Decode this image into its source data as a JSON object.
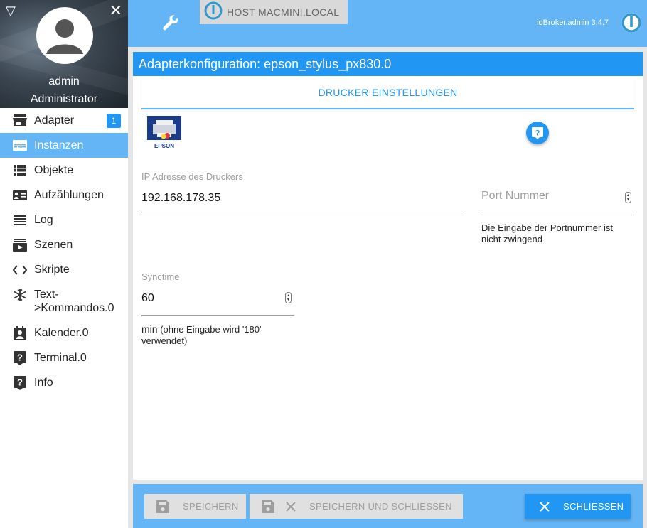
{
  "sidebar": {
    "user_name": "admin",
    "user_role": "Administrator",
    "items": [
      {
        "label": "Adapter",
        "icon": "store-icon",
        "badge": "1",
        "active": false
      },
      {
        "label": "Instanzen",
        "icon": "instances-icon",
        "active": true
      },
      {
        "label": "Objekte",
        "icon": "list-icon",
        "active": false
      },
      {
        "label": "Aufzählungen",
        "icon": "enum-icon",
        "active": false
      },
      {
        "label": "Log",
        "icon": "log-icon",
        "active": false
      },
      {
        "label": "Szenen",
        "icon": "scenes-icon",
        "active": false
      },
      {
        "label": "Skripte",
        "icon": "code-icon",
        "active": false
      },
      {
        "label": "Text->Kommandos.0",
        "icon": "snowflake-icon",
        "active": false
      },
      {
        "label": "Kalender.0",
        "icon": "calendar-icon",
        "active": false
      },
      {
        "label": "Terminal.0",
        "icon": "help-icon",
        "active": false
      },
      {
        "label": "Info",
        "icon": "help-icon",
        "active": false
      }
    ]
  },
  "topbar": {
    "host": "HOST MACMINI.LOCAL",
    "version": "ioBroker.admin 3.4.7"
  },
  "config": {
    "title": "Adapterkonfiguration: epson_stylus_px830.0",
    "tab_label": "DRUCKER EINSTELLUNGEN",
    "logo_text": "EPSON",
    "ip_label": "IP Adresse des Druckers",
    "ip_value": "192.168.178.35",
    "port_placeholder": "Port Nummer",
    "port_helper": "Die Eingabe der Portnummer ist nicht zwingend",
    "synctime_label": "Synctime",
    "synctime_value": "60",
    "synctime_helper_prefix": "min",
    "synctime_helper": "(ohne Eingabe wird '180' verwendet)"
  },
  "footer": {
    "save_label": "SPEICHERN",
    "save_close_label": "SPEICHERN UND SCHLIESSEN",
    "close_label": "SCHLIESSEN"
  },
  "colors": {
    "accent": "#2196f3",
    "bar": "#64b5f6"
  }
}
